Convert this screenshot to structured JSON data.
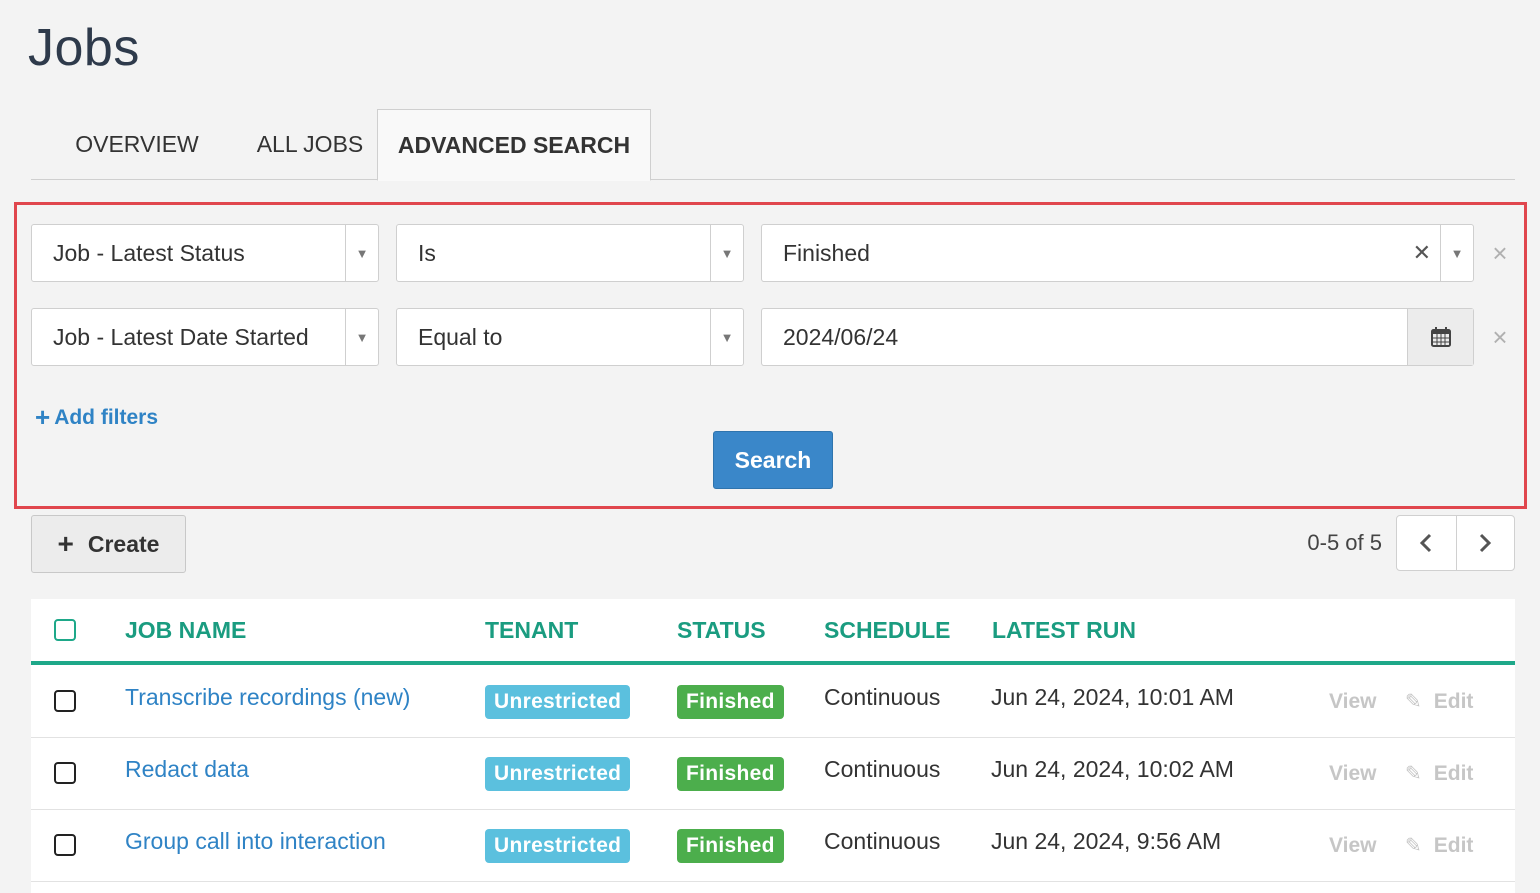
{
  "page": {
    "title": "Jobs"
  },
  "tabs": [
    {
      "label": "OVERVIEW"
    },
    {
      "label": "ALL JOBS"
    },
    {
      "label": "ADVANCED SEARCH"
    }
  ],
  "filters": [
    {
      "field": "Job - Latest Status",
      "operator": "Is",
      "value": "Finished"
    },
    {
      "field": "Job - Latest Date Started",
      "operator": "Equal to",
      "value": "2024/06/24"
    }
  ],
  "add_filters_label": "Add filters",
  "search_label": "Search",
  "toolbar": {
    "create_label": "Create",
    "pager_count": "0-5 of 5"
  },
  "table": {
    "headers": {
      "job_name": "JOB NAME",
      "tenant": "TENANT",
      "status": "STATUS",
      "schedule": "SCHEDULE",
      "latest_run": "LATEST RUN"
    },
    "rows": [
      {
        "name": "Transcribe recordings (new)",
        "tenant": "Unrestricted",
        "status": "Finished",
        "schedule": "Continuous",
        "latest_run": "Jun 24, 2024, 10:01 AM",
        "view": "View",
        "edit": "Edit"
      },
      {
        "name": "Redact data",
        "tenant": "Unrestricted",
        "status": "Finished",
        "schedule": "Continuous",
        "latest_run": "Jun 24, 2024, 10:02 AM",
        "view": "View",
        "edit": "Edit"
      },
      {
        "name": "Group call into interaction",
        "tenant": "Unrestricted",
        "status": "Finished",
        "schedule": "Continuous",
        "latest_run": "Jun 24, 2024, 9:56 AM",
        "view": "View",
        "edit": "Edit"
      }
    ]
  },
  "colors": {
    "accent_teal": "#1ea889",
    "link_blue": "#2f83c5",
    "tenant_badge": "#5bc0de",
    "status_badge": "#4cae4c",
    "highlight_border": "#e0464d",
    "search_button": "#3a87c9"
  }
}
